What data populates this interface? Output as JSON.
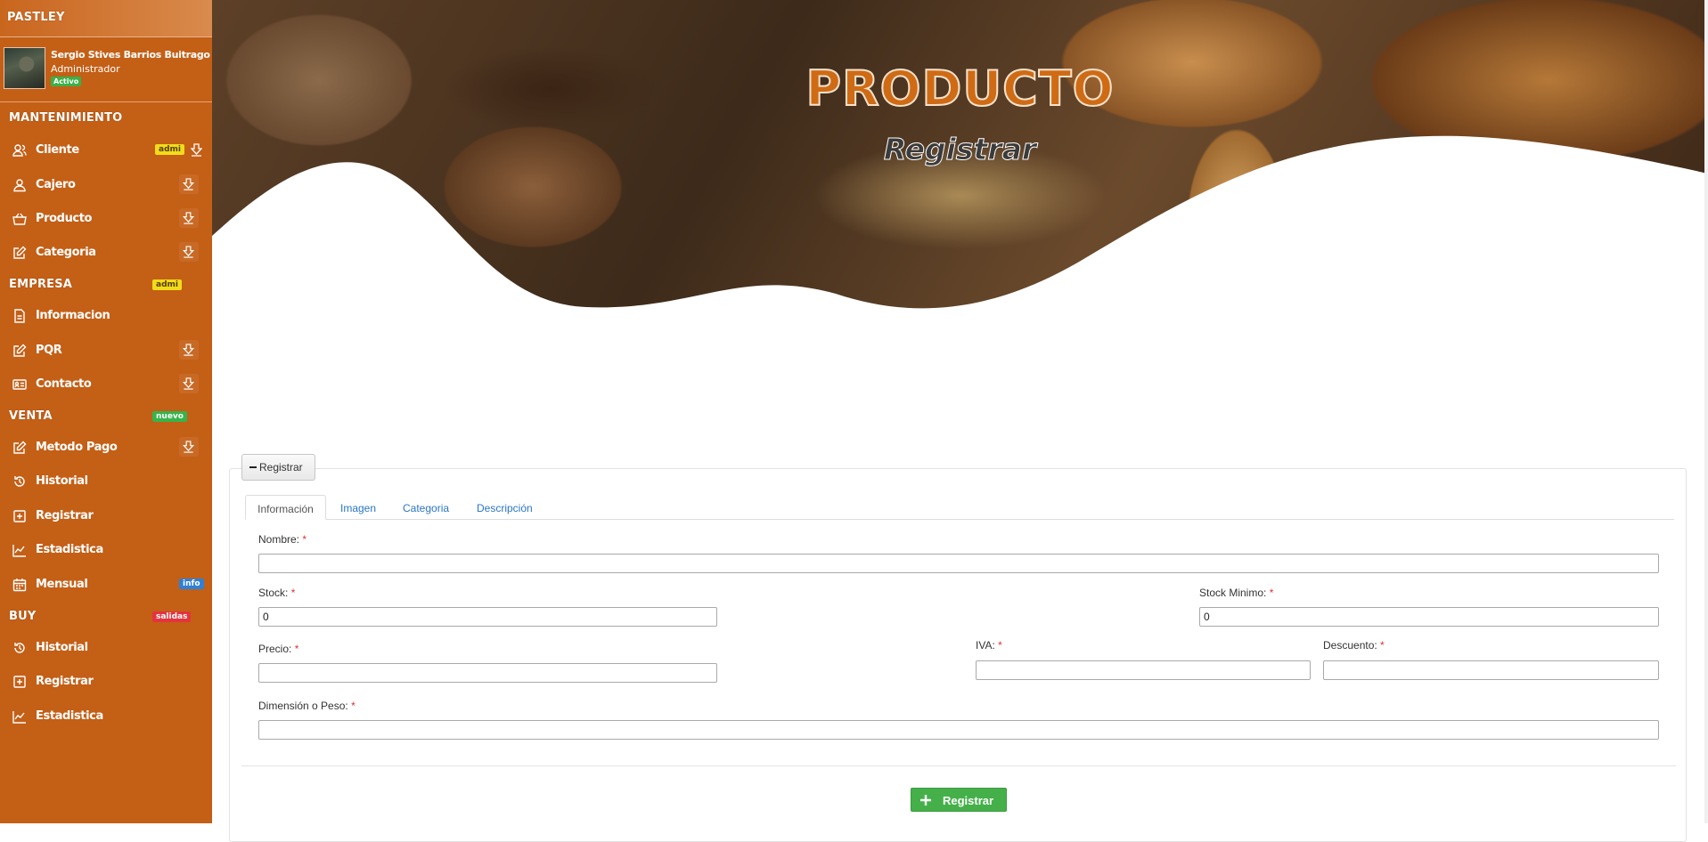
{
  "sidebar": {
    "brand": "PASTLEY",
    "user": {
      "name": "Sergio Stives Barrios Buitrago",
      "role": "Administrador",
      "status": "Activo"
    },
    "sections": {
      "mantenimiento": "MANTENIMIENTO",
      "empresa": "EMPRESA",
      "empresa_badge": "admi",
      "venta": "VENTA",
      "venta_badge": "nuevo",
      "buy": "BUY",
      "buy_badge": "salidas"
    },
    "items": {
      "cliente": "Cliente",
      "cliente_badge": "admi",
      "cajero": "Cajero",
      "producto": "Producto",
      "categoria": "Categoria",
      "informacion": "Informacion",
      "pqr": "PQR",
      "contacto": "Contacto",
      "metodo_pago": "Metodo Pago",
      "historial": "Historial",
      "registrar": "Registrar",
      "estadistica": "Estadistica",
      "mensual": "Mensual",
      "mensual_badge": "info",
      "buy_historial": "Historial",
      "buy_registrar": "Registrar",
      "buy_estadistica": "Estadistica"
    }
  },
  "hero": {
    "title": "PRODUCTO",
    "subtitle": "Registrar"
  },
  "form": {
    "legend": "Registrar",
    "tabs": [
      "Información",
      "Imagen",
      "Categoria",
      "Descripción"
    ],
    "fields": {
      "nombre_label": "Nombre:",
      "nombre_value": "",
      "stock_label": "Stock:",
      "stock_value": "0",
      "stock_minimo_label": "Stock Minimo:",
      "stock_minimo_value": "0",
      "precio_label": "Precio:",
      "precio_value": "",
      "iva_label": "IVA:",
      "iva_value": "",
      "descuento_label": "Descuento:",
      "descuento_value": "",
      "dimension_label": "Dimensión o Peso:",
      "dimension_value": ""
    },
    "required_mark": "*",
    "submit_label": "Registrar"
  },
  "colors": {
    "sidebar": "#c45f16",
    "hero_title": "#cf6b15",
    "submit": "#45b049",
    "link": "#2a76c6"
  }
}
